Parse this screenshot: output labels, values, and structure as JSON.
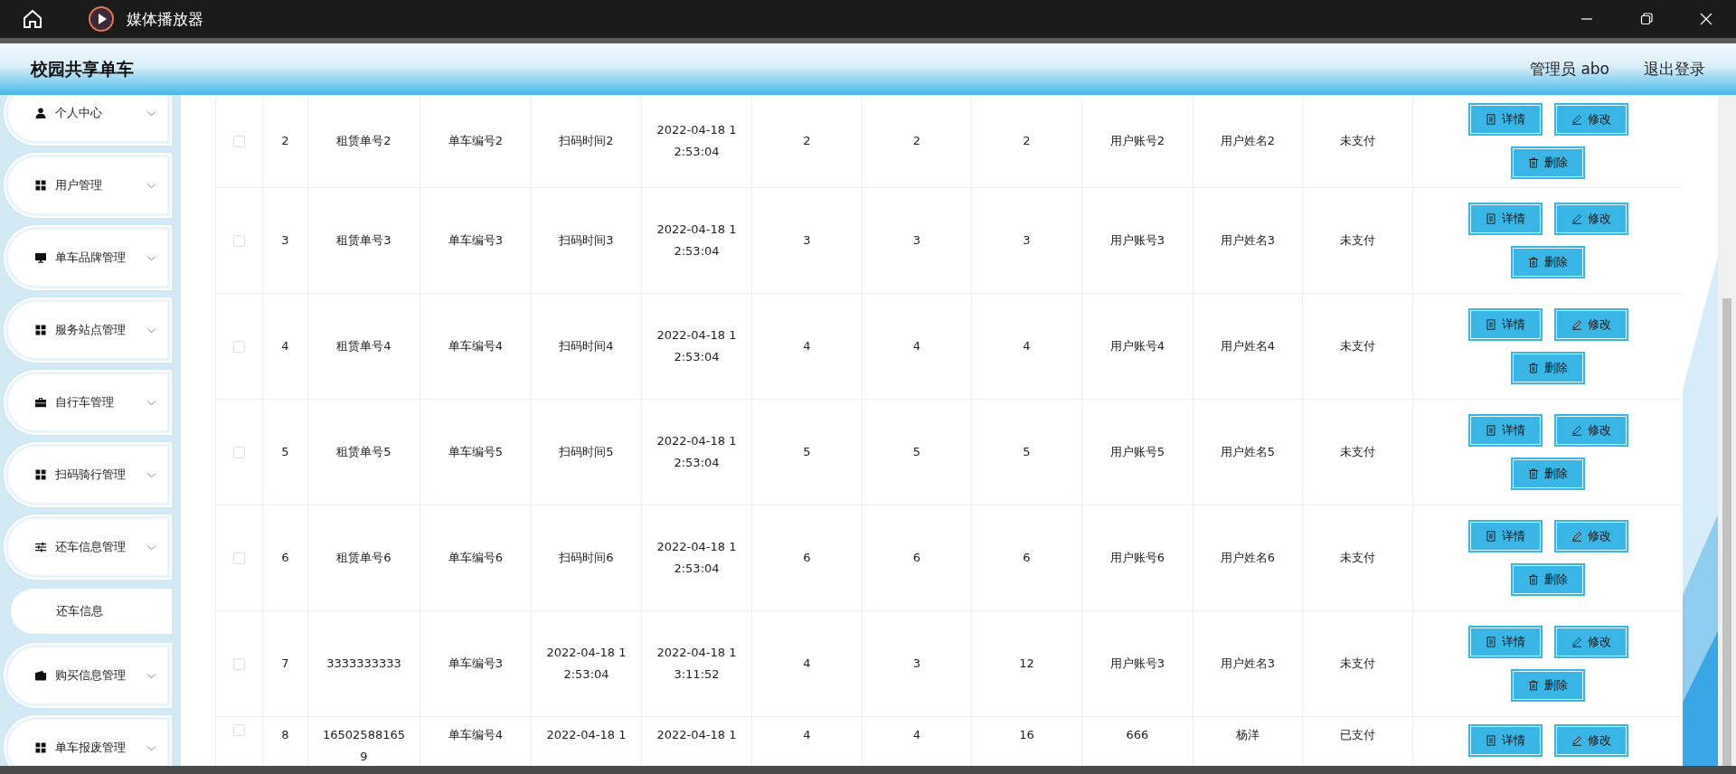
{
  "window": {
    "title": "媒体播放器"
  },
  "header": {
    "brand": "校园共享单车",
    "user": "管理员 abo",
    "logout": "退出登录"
  },
  "sidebar": {
    "items": [
      {
        "label": "个人中心",
        "kind": "person"
      },
      {
        "label": "用户管理",
        "kind": "grid"
      },
      {
        "label": "单车品牌管理",
        "kind": "monitor"
      },
      {
        "label": "服务站点管理",
        "kind": "grid"
      },
      {
        "label": "自行车管理",
        "kind": "briefcase"
      },
      {
        "label": "扫码骑行管理",
        "kind": "grid"
      },
      {
        "label": "还车信息管理",
        "kind": "sliders",
        "children": [
          {
            "label": "还车信息"
          }
        ]
      },
      {
        "label": "购买信息管理",
        "kind": "wallet"
      },
      {
        "label": "单车报废管理",
        "kind": "grid"
      }
    ]
  },
  "table": {
    "rows": [
      {
        "checked": false,
        "index": "2",
        "cells": [
          "租赁单号2",
          "单车编号2",
          "扫码时间2",
          "2022-04-18 12:53:04",
          "2",
          "2",
          "2",
          "用户账号2",
          "用户姓名2",
          "未支付"
        ],
        "actions": [
          {
            "label": "详情",
            "kind": "detail"
          },
          {
            "label": "修改",
            "kind": "edit"
          },
          {
            "label": "删除",
            "kind": "delete"
          }
        ]
      },
      {
        "checked": false,
        "index": "3",
        "cells": [
          "租赁单号3",
          "单车编号3",
          "扫码时间3",
          "2022-04-18 12:53:04",
          "3",
          "3",
          "3",
          "用户账号3",
          "用户姓名3",
          "未支付"
        ],
        "actions": [
          {
            "label": "详情",
            "kind": "detail"
          },
          {
            "label": "修改",
            "kind": "edit"
          },
          {
            "label": "删除",
            "kind": "delete"
          }
        ]
      },
      {
        "checked": false,
        "index": "4",
        "cells": [
          "租赁单号4",
          "单车编号4",
          "扫码时间4",
          "2022-04-18 12:53:04",
          "4",
          "4",
          "4",
          "用户账号4",
          "用户姓名4",
          "未支付"
        ],
        "actions": [
          {
            "label": "详情",
            "kind": "detail"
          },
          {
            "label": "修改",
            "kind": "edit"
          },
          {
            "label": "删除",
            "kind": "delete"
          }
        ]
      },
      {
        "checked": false,
        "index": "5",
        "cells": [
          "租赁单号5",
          "单车编号5",
          "扫码时间5",
          "2022-04-18 12:53:04",
          "5",
          "5",
          "5",
          "用户账号5",
          "用户姓名5",
          "未支付"
        ],
        "actions": [
          {
            "label": "详情",
            "kind": "detail"
          },
          {
            "label": "修改",
            "kind": "edit"
          },
          {
            "label": "删除",
            "kind": "delete"
          }
        ]
      },
      {
        "checked": false,
        "index": "6",
        "cells": [
          "租赁单号6",
          "单车编号6",
          "扫码时间6",
          "2022-04-18 12:53:04",
          "6",
          "6",
          "6",
          "用户账号6",
          "用户姓名6",
          "未支付"
        ],
        "actions": [
          {
            "label": "详情",
            "kind": "detail"
          },
          {
            "label": "修改",
            "kind": "edit"
          },
          {
            "label": "删除",
            "kind": "delete"
          }
        ]
      },
      {
        "checked": false,
        "index": "7",
        "cells": [
          "3333333333",
          "单车编号3",
          "2022-04-18 12:53:04",
          "2022-04-18 13:11:52",
          "4",
          "3",
          "12",
          "用户账号3",
          "用户姓名3",
          "未支付"
        ],
        "actions": [
          {
            "label": "详情",
            "kind": "detail"
          },
          {
            "label": "修改",
            "kind": "edit"
          },
          {
            "label": "删除",
            "kind": "delete"
          }
        ]
      },
      {
        "checked": false,
        "index": "8",
        "cells": [
          "165025881659",
          "单车编号4",
          "2022-04-18 1",
          "2022-04-18 1",
          "4",
          "4",
          "16",
          "666",
          "杨洋",
          "已支付"
        ],
        "actions": [
          {
            "label": "详情",
            "kind": "detail"
          },
          {
            "label": "修改",
            "kind": "edit"
          }
        ]
      }
    ]
  }
}
